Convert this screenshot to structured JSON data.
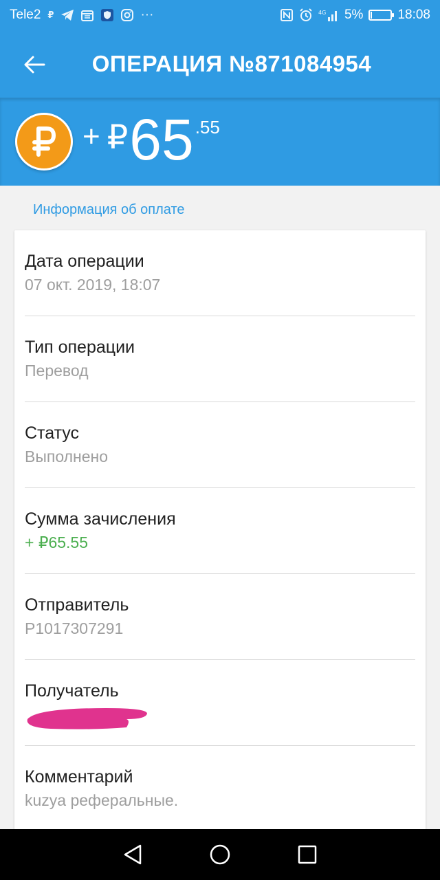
{
  "status_bar": {
    "carrier": "Tele2",
    "battery_percent": "5%",
    "time": "18:08"
  },
  "app_bar": {
    "title": "ОПЕРАЦИЯ №871084954"
  },
  "amount": {
    "sign": "+",
    "currency_symbol": "₽",
    "integer": "65",
    "fraction": ".55"
  },
  "section_title": "Информация об оплате",
  "details": [
    {
      "label": "Дата операции",
      "value": "07 окт. 2019, 18:07"
    },
    {
      "label": "Тип операции",
      "value": "Перевод"
    },
    {
      "label": "Статус",
      "value": "Выполнено"
    },
    {
      "label": "Сумма зачисления",
      "value": "+ ₽65.55"
    },
    {
      "label": "Отправитель",
      "value": "P1017307291"
    },
    {
      "label": "Получатель",
      "value": ""
    },
    {
      "label": "Комментарий",
      "value": "kuzya реферальные."
    }
  ],
  "colors": {
    "primary": "#2f9be3",
    "coin": "#f39a18",
    "credit_green": "#4caf50",
    "redaction": "#e0338e"
  }
}
